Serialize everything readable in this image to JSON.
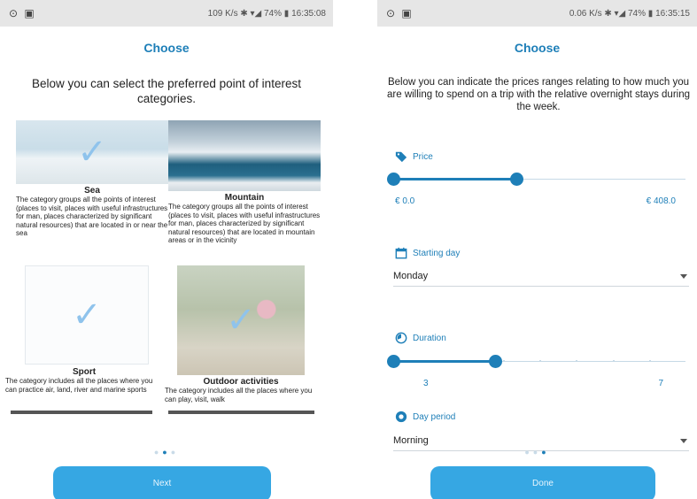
{
  "left_screen": {
    "status": {
      "left_icons": "⊙ ▣",
      "right": "109 K/s ✱ ▾◢ 74% ▮ 16:35:08"
    },
    "title": "Choose",
    "intro": "Below you can select the preferred point of interest categories.",
    "categories": [
      {
        "name": "Sea",
        "description": "The category groups all the points of interest (places to visit, places with useful infrastructures for man, places characterized by significant natural resources) that are located in or near the sea",
        "selected": true
      },
      {
        "name": "Mountain",
        "description": "The category groups all the points of interest (places to visit, places with useful infrastructures for man, places characterized by significant natural resources) that are located in mountain areas or in the vicinity",
        "selected": false
      },
      {
        "name": "Sport",
        "description": "The category includes all the places where you can practice air, land, river and marine sports",
        "selected": true
      },
      {
        "name": "Outdoor activities",
        "description": "The category includes all the places where you can play, visit, walk",
        "selected": true
      }
    ],
    "pager": {
      "count": 3,
      "active": 1
    },
    "button_label": "Next"
  },
  "right_screen": {
    "status": {
      "left_icons": "⊙ ▣",
      "right": "0.06 K/s ✱ ▾◢ 74% ▮ 16:35:15"
    },
    "title": "Choose",
    "intro": "Below you can indicate the prices ranges relating to how much you are willing to spend on a trip with the relative overnight stays during the week.",
    "price": {
      "label": "Price",
      "min_label": "€ 0.0",
      "max_label": "€ 408.0",
      "range_fraction": 0.42
    },
    "starting_day": {
      "label": "Starting day",
      "value": "Monday"
    },
    "duration": {
      "label": "Duration",
      "min_label": "3",
      "max_label": "7",
      "range_fraction": 0.35,
      "ticks": 8
    },
    "day_period": {
      "label": "Day period",
      "value": "Morning"
    },
    "pager": {
      "count": 3,
      "active": 2
    },
    "button_label": "Done"
  },
  "colors": {
    "accent": "#1e7fb8",
    "button": "#36a7e3"
  }
}
